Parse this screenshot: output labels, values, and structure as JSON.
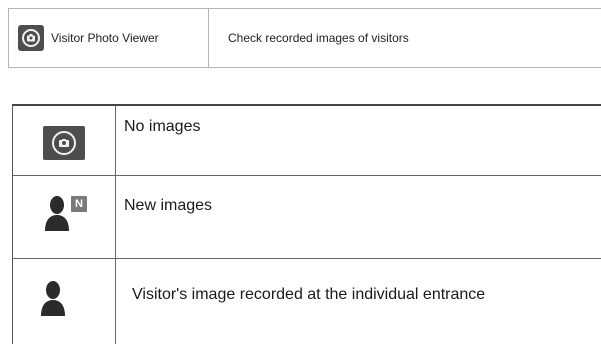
{
  "header": {
    "app_icon": "camera-icon",
    "app_name": "Visitor Photo Viewer",
    "description": "Check recorded images of visitors"
  },
  "legend": {
    "rows": [
      {
        "icon": "camera-icon",
        "label": "No images"
      },
      {
        "icon": "person-new-icon",
        "badge": "N",
        "label": "New images"
      },
      {
        "icon": "person-icon",
        "label": "Visitor's image recorded at the individual entrance"
      }
    ]
  }
}
